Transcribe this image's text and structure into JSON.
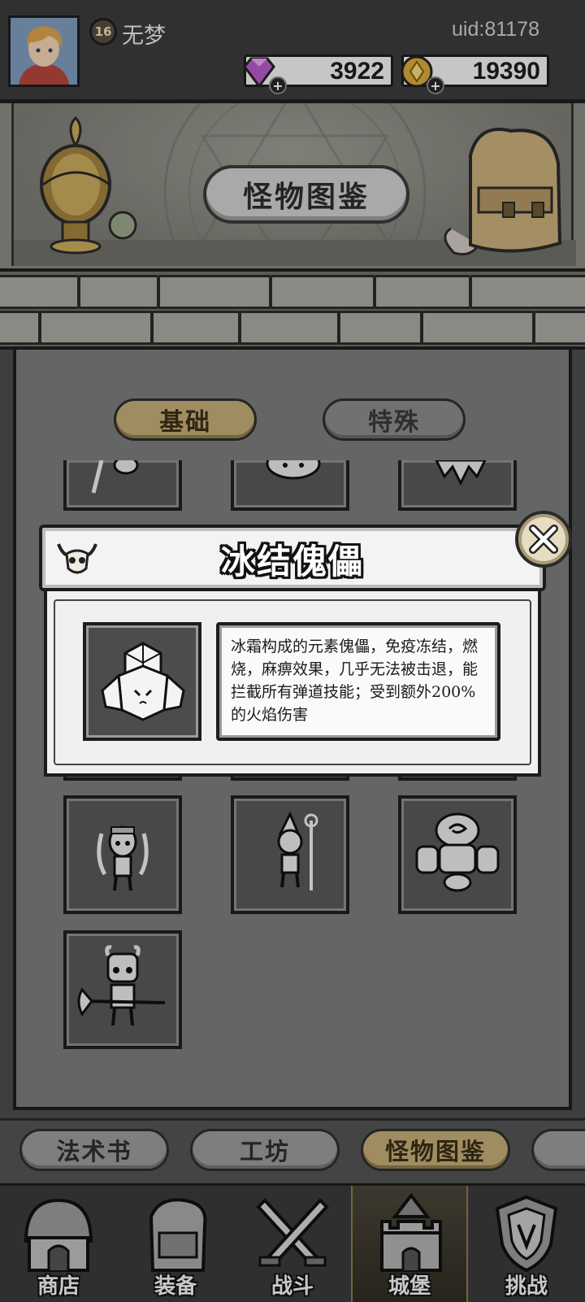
{
  "player": {
    "level": "16",
    "name": "无梦",
    "uid": "uid:81178"
  },
  "currencies": {
    "gems": "3922",
    "gold": "19390"
  },
  "banner": {
    "title": "怪物图鉴"
  },
  "tabs": [
    {
      "label": "基础",
      "active": true
    },
    {
      "label": "特殊",
      "active": false
    }
  ],
  "modal": {
    "title": "冰结傀儡",
    "description": "冰霜构成的元素傀儡，免疫冻结，燃烧，麻痹效果，几乎无法被击退，能拦截所有弹道技能；受到额外200%的火焰伤害"
  },
  "monsters": [
    "dual-blade-skeleton",
    "spear-skeleton-mage",
    "stone-golem",
    "horned-axe-skeleton"
  ],
  "submenu": [
    {
      "label": "法术书"
    },
    {
      "label": "工坊"
    },
    {
      "label": "怪物图鉴",
      "active": true
    }
  ],
  "nav": [
    {
      "label": "商店",
      "icon": "shop-icon"
    },
    {
      "label": "装备",
      "icon": "backpack-icon"
    },
    {
      "label": "战斗",
      "icon": "crossed-swords-icon"
    },
    {
      "label": "城堡",
      "icon": "castle-icon",
      "active": true
    },
    {
      "label": "挑战",
      "icon": "challenge-shield-icon"
    }
  ],
  "colors": {
    "accent_gold": "#c3ac77",
    "panel_gray": "#7c7c7c",
    "dark": "#1d1d1d"
  }
}
